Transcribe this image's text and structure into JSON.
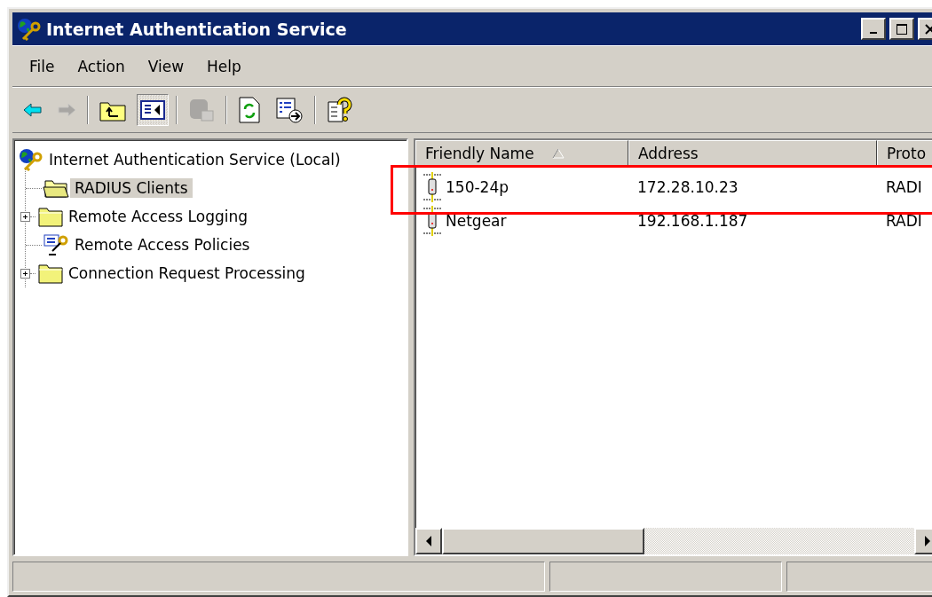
{
  "window": {
    "title": "Internet Authentication Service"
  },
  "menu": [
    {
      "label": "File"
    },
    {
      "label": "Action"
    },
    {
      "label": "View"
    },
    {
      "label": "Help"
    }
  ],
  "toolbar": [
    {
      "kind": "back",
      "disabled": false,
      "pressed": false
    },
    {
      "kind": "forward",
      "disabled": true,
      "pressed": false
    },
    {
      "kind": "separator"
    },
    {
      "kind": "up",
      "disabled": false,
      "pressed": false
    },
    {
      "kind": "tree",
      "disabled": false,
      "pressed": true
    },
    {
      "kind": "separator"
    },
    {
      "kind": "delete",
      "disabled": true,
      "pressed": false
    },
    {
      "kind": "separator"
    },
    {
      "kind": "refresh",
      "disabled": false,
      "pressed": false
    },
    {
      "kind": "export",
      "disabled": false,
      "pressed": false
    },
    {
      "kind": "separator"
    },
    {
      "kind": "help",
      "disabled": false,
      "pressed": false
    }
  ],
  "tree": {
    "label": "Internet Authentication Service (Local)",
    "kind": "service",
    "selected": false,
    "children": [
      {
        "label": "RADIUS Clients",
        "kind": "folder",
        "selected": true
      },
      {
        "label": "Remote Access Logging",
        "kind": "folder",
        "selected": false,
        "expanded": false
      },
      {
        "label": "Remote Access Policies",
        "kind": "policy",
        "selected": false
      },
      {
        "label": "Connection Request Processing",
        "kind": "folder",
        "selected": false,
        "expanded": false
      }
    ]
  },
  "table": {
    "columns": [
      {
        "label": "Friendly Name",
        "sorted": true
      },
      {
        "label": "Address",
        "sorted": false
      },
      {
        "label": "Proto"
      }
    ],
    "rows": [
      {
        "cells": [
          "150-24p",
          "172.28.10.23",
          "RADI"
        ]
      },
      {
        "cells": [
          "Netgear",
          "192.168.1.187",
          "RADI"
        ]
      }
    ]
  }
}
